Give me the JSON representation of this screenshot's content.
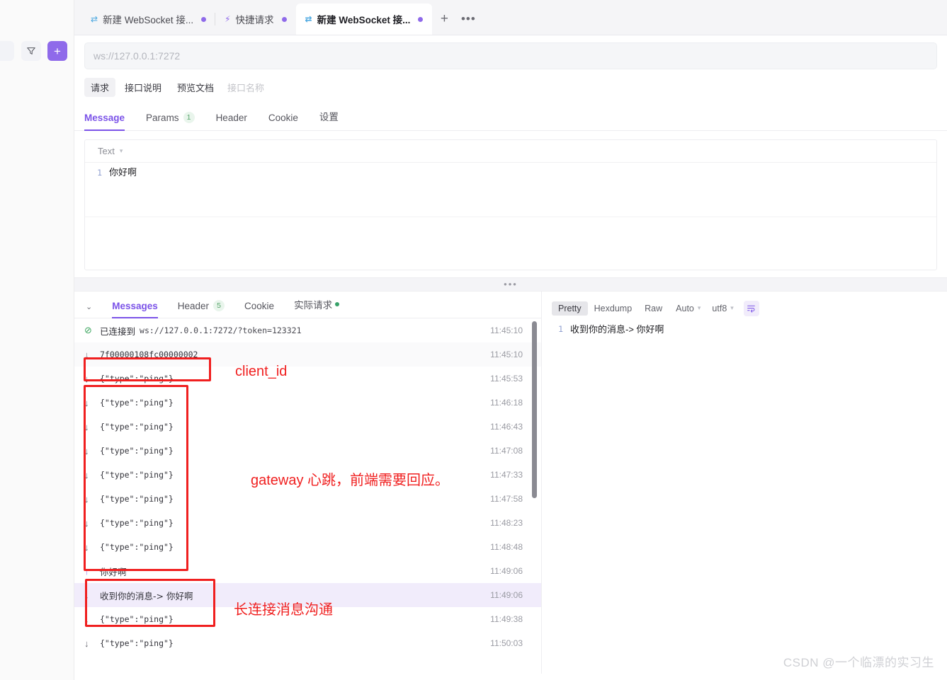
{
  "left_rail": {
    "filter_icon": "filter-icon",
    "add_label": "+"
  },
  "window_tabs": [
    {
      "icon": "websocket-icon",
      "label": "新建 WebSocket 接...",
      "active": false,
      "dirty": true
    },
    {
      "icon": "bolt-icon",
      "label": "快捷请求",
      "active": false,
      "dirty": true
    },
    {
      "icon": "websocket-icon",
      "label": "新建 WebSocket 接...",
      "active": true,
      "dirty": true
    }
  ],
  "tabstrip_actions": {
    "new_tab": "+",
    "more": "•••"
  },
  "urlbar": {
    "placeholder": "ws://127.0.0.1:7272",
    "value": ""
  },
  "doc_tabs": [
    {
      "label": "请求",
      "selected": true
    },
    {
      "label": "接口说明",
      "selected": false
    },
    {
      "label": "预览文档",
      "selected": false
    }
  ],
  "doc_name_placeholder": "接口名称",
  "section_tabs": [
    {
      "label": "Message",
      "active": true,
      "badge": ""
    },
    {
      "label": "Params",
      "active": false,
      "badge": "1"
    },
    {
      "label": "Header",
      "active": false,
      "badge": ""
    },
    {
      "label": "Cookie",
      "active": false,
      "badge": ""
    },
    {
      "label": "设置",
      "active": false,
      "badge": ""
    }
  ],
  "editor": {
    "format_label": "Text",
    "line_number": "1",
    "content": "你好啊"
  },
  "lower_tabs": [
    {
      "label": "Messages",
      "active": true,
      "badge": "",
      "dot": false
    },
    {
      "label": "Header",
      "active": false,
      "badge": "5",
      "dot": false
    },
    {
      "label": "Cookie",
      "active": false,
      "badge": "",
      "dot": false
    },
    {
      "label": "实际请求",
      "active": false,
      "badge": "",
      "dot": true
    }
  ],
  "connection": {
    "status_icon": "check-circle-icon",
    "label": "已连接到",
    "url": "ws://127.0.0.1:7272/?token=123321",
    "time": "11:45:10"
  },
  "messages": [
    {
      "dir": "in",
      "text": "7f00000108fc00000002",
      "time": "11:45:10",
      "mono": true,
      "alt": true,
      "hl": false
    },
    {
      "dir": "in",
      "text": "{\"type\":\"ping\"}",
      "time": "11:45:53",
      "mono": true,
      "alt": false,
      "hl": false
    },
    {
      "dir": "in",
      "text": "{\"type\":\"ping\"}",
      "time": "11:46:18",
      "mono": true,
      "alt": false,
      "hl": false
    },
    {
      "dir": "in",
      "text": "{\"type\":\"ping\"}",
      "time": "11:46:43",
      "mono": true,
      "alt": false,
      "hl": false
    },
    {
      "dir": "in",
      "text": "{\"type\":\"ping\"}",
      "time": "11:47:08",
      "mono": true,
      "alt": false,
      "hl": false
    },
    {
      "dir": "in",
      "text": "{\"type\":\"ping\"}",
      "time": "11:47:33",
      "mono": true,
      "alt": false,
      "hl": false
    },
    {
      "dir": "in",
      "text": "{\"type\":\"ping\"}",
      "time": "11:47:58",
      "mono": true,
      "alt": false,
      "hl": false
    },
    {
      "dir": "in",
      "text": "{\"type\":\"ping\"}",
      "time": "11:48:23",
      "mono": true,
      "alt": false,
      "hl": false
    },
    {
      "dir": "in",
      "text": "{\"type\":\"ping\"}",
      "time": "11:48:48",
      "mono": true,
      "alt": false,
      "hl": false
    },
    {
      "dir": "out",
      "text": "你好啊",
      "time": "11:49:06",
      "mono": false,
      "alt": false,
      "hl": false
    },
    {
      "dir": "in",
      "text": "收到你的消息-> 你好啊",
      "time": "11:49:06",
      "mono": false,
      "alt": false,
      "hl": true
    },
    {
      "dir": "in",
      "text": "{\"type\":\"ping\"}",
      "time": "11:49:38",
      "mono": true,
      "alt": false,
      "hl": false
    },
    {
      "dir": "in",
      "text": "{\"type\":\"ping\"}",
      "time": "11:50:03",
      "mono": true,
      "alt": false,
      "hl": false
    }
  ],
  "arrow_in": "↓",
  "arrow_out": "↑",
  "annotations": [
    {
      "text": "client_id"
    },
    {
      "text": "gateway 心跳，前端需要回应。"
    },
    {
      "text": "长连接消息沟通"
    }
  ],
  "result_toolbar": {
    "views": [
      {
        "label": "Pretty",
        "on": true
      },
      {
        "label": "Hexdump",
        "on": false
      },
      {
        "label": "Raw",
        "on": false
      }
    ],
    "auto_label": "Auto",
    "charset_label": "utf8",
    "wrap_icon": "wrap-text-icon"
  },
  "result": {
    "line_number": "1",
    "content": "收到你的消息-> 你好啊"
  },
  "watermark": "CSDN @一个临漂的实习生",
  "colors": {
    "accent": "#7b53e8",
    "annotation": "#f01f1f",
    "success": "#3aa55d",
    "highlight_row": "#f1ecfb"
  }
}
